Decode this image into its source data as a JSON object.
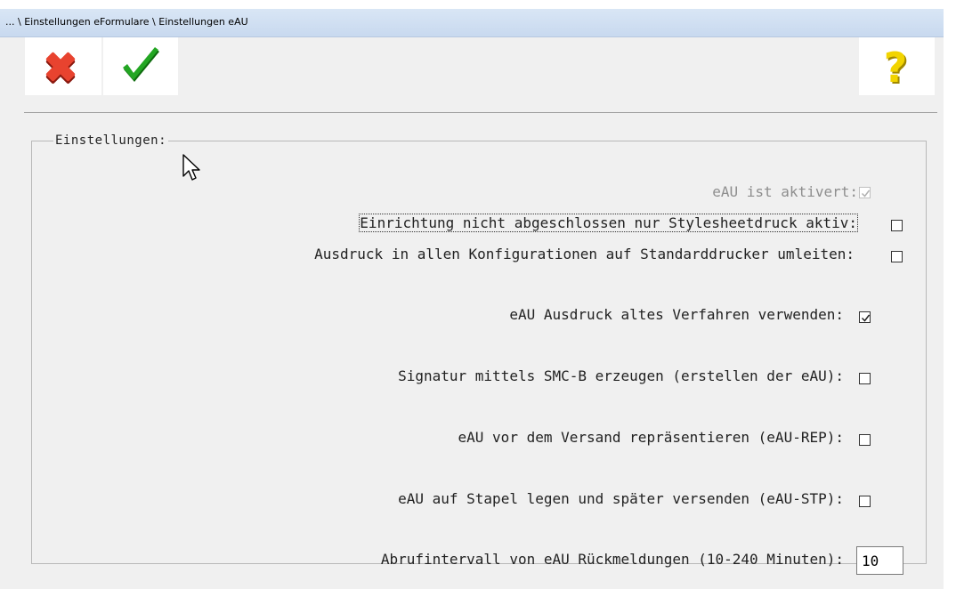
{
  "window": {
    "title": "... \\ Einstellungen eFormulare \\ Einstellungen eAU"
  },
  "toolbar": {
    "cancel_icon": "cancel-x-icon",
    "confirm_icon": "checkmark-icon",
    "help_icon": "help-question-icon"
  },
  "settings": {
    "legend": "Einstellungen:",
    "items": [
      {
        "label": "eAU ist aktivert:",
        "checked": true,
        "enabled": false
      },
      {
        "label": "Einrichtung nicht abgeschlossen nur Stylesheetdruck aktiv:",
        "checked": false,
        "enabled": true,
        "focused": true
      },
      {
        "label": "Ausdruck in allen Konfigurationen auf Standarddrucker umleiten:",
        "checked": false,
        "enabled": true
      },
      {
        "label": "eAU Ausdruck altes Verfahren verwenden:",
        "checked": true,
        "enabled": true
      },
      {
        "label": "Signatur mittels SMC-B erzeugen (erstellen der eAU):",
        "checked": false,
        "enabled": true
      },
      {
        "label": "eAU vor dem Versand repräsentieren (eAU-REP):",
        "checked": false,
        "enabled": true
      },
      {
        "label": "eAU auf Stapel legen und später versenden (eAU-STP):",
        "checked": false,
        "enabled": true
      }
    ],
    "interval": {
      "label": "Abrufintervall von eAU Rückmeldungen (10-240 Minuten):",
      "value": "10"
    }
  },
  "colors": {
    "cancel": "#e8432f",
    "confirm": "#1f9a1f",
    "help": "#f2d400"
  }
}
